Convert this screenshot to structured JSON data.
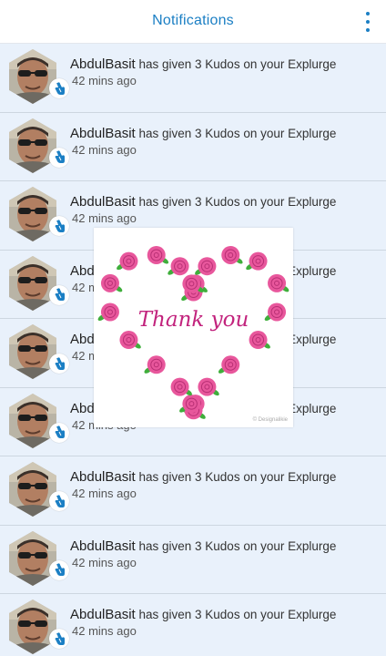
{
  "header": {
    "title": "Notifications"
  },
  "notifications": [
    {
      "name": "AbdulBasit",
      "message": "has given 3 Kudos on your Explurge",
      "time": "42 mins ago"
    },
    {
      "name": "AbdulBasit",
      "message": "has given 3 Kudos on your Explurge",
      "time": "42 mins ago"
    },
    {
      "name": "AbdulBasit",
      "message": "has given 3 Kudos on your Explurge",
      "time": "42 mins ago"
    },
    {
      "name": "AbdulBasit",
      "message": "has given 3 Kudos on your Explurge",
      "time": "42 mins ago"
    },
    {
      "name": "AbdulBasit",
      "message": "has given 3 Kudos on your Explurge",
      "time": "42 mins ago"
    },
    {
      "name": "AbdulBasit",
      "message": "has given 3 Kudos on your Explurge",
      "time": "42 mins ago"
    },
    {
      "name": "AbdulBasit",
      "message": "has given 3 Kudos on your Explurge",
      "time": "42 mins ago"
    },
    {
      "name": "AbdulBasit",
      "message": "has given 3 Kudos on your Explurge",
      "time": "42 mins ago"
    },
    {
      "name": "AbdulBasit",
      "message": "has given 3 Kudos on your Explurge",
      "time": "42 mins ago"
    }
  ],
  "overlay": {
    "text": "Thank you",
    "watermark": "© Designalikie"
  },
  "colors": {
    "accent": "#1b7fc4",
    "row_bg": "#e9f1fb",
    "rose": "#e8579c",
    "leaf": "#3fae3b",
    "script_text": "#c2237d"
  },
  "icons": {
    "menu": "vertical-dots-icon",
    "badge": "kudos-hand-icon"
  }
}
